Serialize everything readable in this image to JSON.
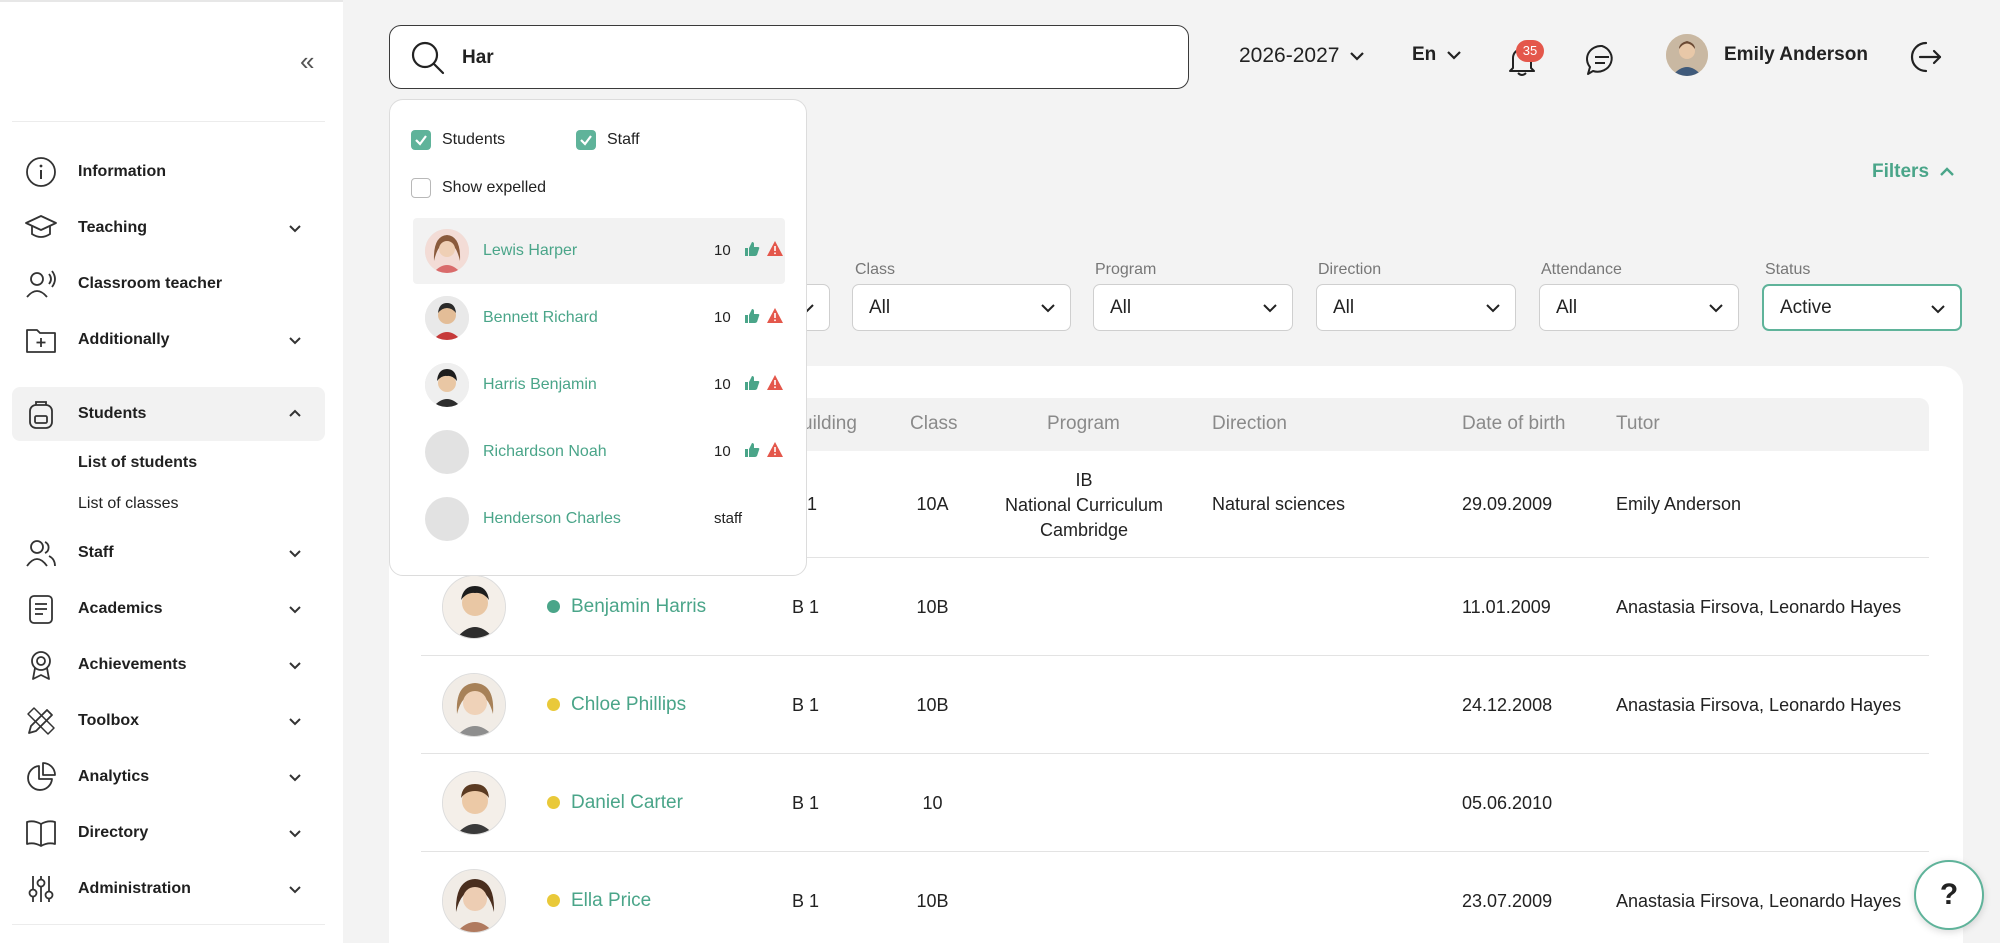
{
  "search": {
    "value": "Har",
    "placeholder": ""
  },
  "topbar": {
    "year": "2026-2027",
    "language": "En",
    "notifications_count": "35",
    "user_name": "Emily Anderson"
  },
  "sidebar": {
    "items": [
      {
        "label": "Information"
      },
      {
        "label": "Teaching"
      },
      {
        "label": "Classroom teacher"
      },
      {
        "label": "Additionally"
      },
      {
        "label": "Students"
      },
      {
        "label": "Staff"
      },
      {
        "label": "Academics"
      },
      {
        "label": "Achievements"
      },
      {
        "label": "Toolbox"
      },
      {
        "label": "Analytics"
      },
      {
        "label": "Directory"
      },
      {
        "label": "Administration"
      }
    ],
    "subitems": [
      {
        "label": "List of students"
      },
      {
        "label": "List of classes"
      }
    ]
  },
  "filters": {
    "toggle_label": "Filters",
    "fields": [
      {
        "label": "Class",
        "value": "All"
      },
      {
        "label": "Program",
        "value": "All"
      },
      {
        "label": "Direction",
        "value": "All"
      },
      {
        "label": "Attendance",
        "value": "All"
      },
      {
        "label": "Status",
        "value": "Active"
      }
    ]
  },
  "table": {
    "headers": {
      "building": "uilding",
      "class": "Class",
      "program": "Program",
      "direction": "Direction",
      "dob": "Date of birth",
      "tutor": "Tutor"
    },
    "first_row": {
      "building": "1",
      "class": "10A",
      "program_lines": [
        "IB",
        "National Curriculum",
        "Cambridge"
      ],
      "direction": "Natural sciences",
      "dob": "29.09.2009",
      "tutor": "Emily Anderson"
    },
    "rows": [
      {
        "name": "Benjamin Harris",
        "status_color": "#4aa589",
        "building": "B 1",
        "class": "10B",
        "dob": "11.01.2009",
        "tutor": "Anastasia Firsova, Leonardo Hayes"
      },
      {
        "name": "Chloe Phillips",
        "status_color": "#e9c939",
        "building": "B 1",
        "class": "10B",
        "dob": "24.12.2008",
        "tutor": "Anastasia Firsova, Leonardo Hayes"
      },
      {
        "name": "Daniel Carter",
        "status_color": "#e9c939",
        "building": "B 1",
        "class": "10",
        "dob": "05.06.2010",
        "tutor": ""
      },
      {
        "name": "Ella Price",
        "status_color": "#e9c939",
        "building": "B 1",
        "class": "10B",
        "dob": "23.07.2009",
        "tutor": "Anastasia Firsova, Leonardo Hayes"
      }
    ]
  },
  "dropdown": {
    "students_label": "Students",
    "staff_label": "Staff",
    "expelled_label": "Show expelled",
    "results": [
      {
        "name": "Lewis Harper",
        "grade": "10"
      },
      {
        "name": "Bennett Richard",
        "grade": "10"
      },
      {
        "name": "Harris Benjamin",
        "grade": "10"
      },
      {
        "name": "Richardson Noah",
        "grade": "10"
      },
      {
        "name": "Henderson Charles",
        "grade": "staff"
      }
    ]
  },
  "help": {
    "label": "?"
  },
  "colors": {
    "accent": "#4aa589",
    "warning": "#e4574b",
    "pending": "#e9c939"
  }
}
